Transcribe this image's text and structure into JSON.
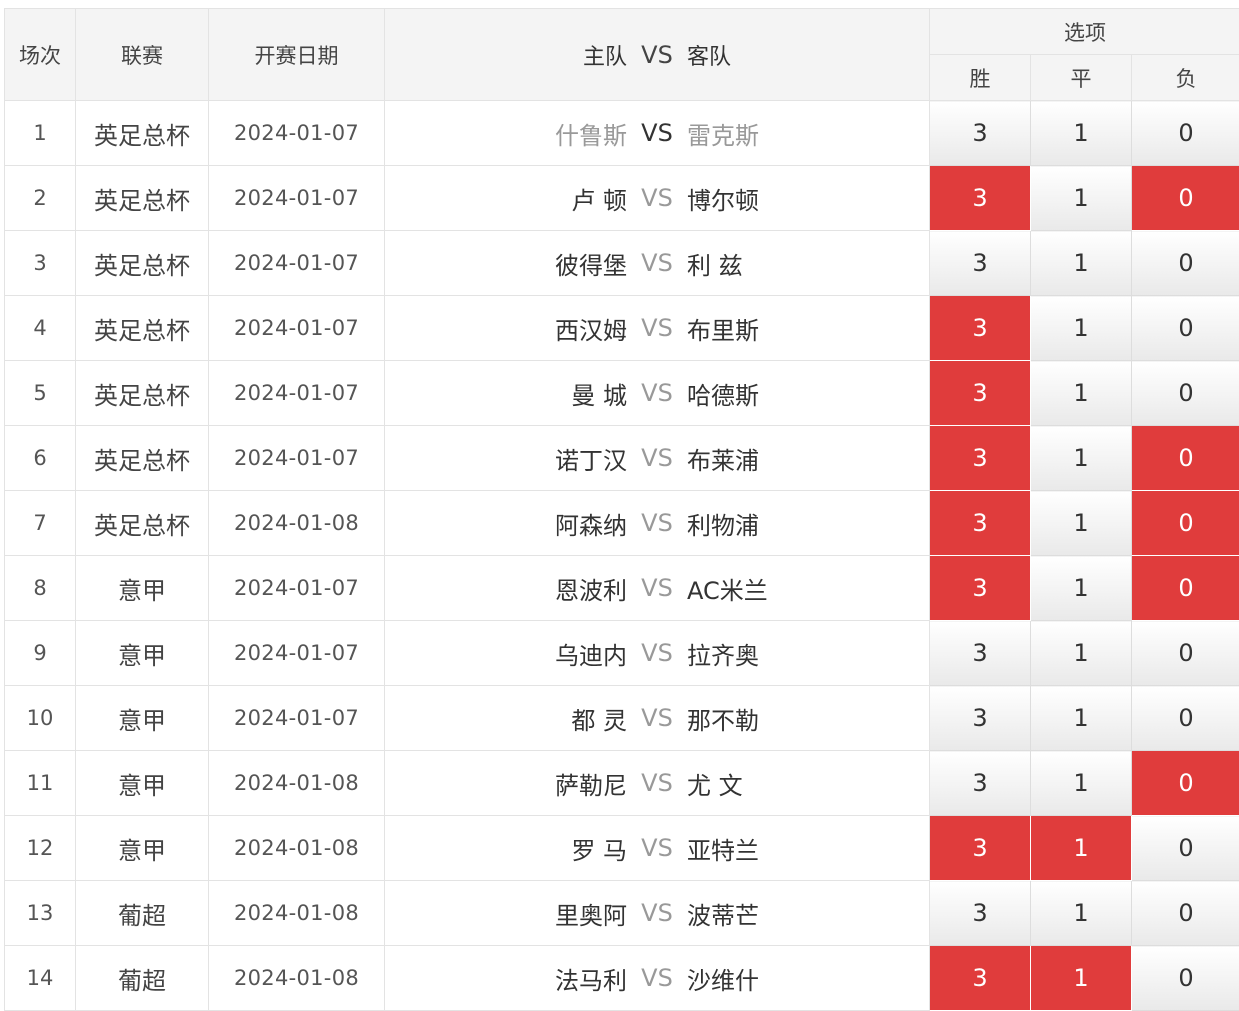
{
  "header": {
    "no": "场次",
    "league": "联赛",
    "date": "开赛日期",
    "home": "主队",
    "vs": "VS",
    "away": "客队",
    "options": "选项",
    "win": "胜",
    "draw": "平",
    "lose": "负"
  },
  "colors": {
    "selected": "#e03c3c",
    "muted_text": "#999999"
  },
  "rows": [
    {
      "no": "1",
      "league": "英足总杯",
      "date": "2024-01-07",
      "home": "什鲁斯",
      "vs": "VS",
      "away": "雷克斯",
      "muted": true,
      "win": "3",
      "draw": "1",
      "lose": "0",
      "sel": [
        false,
        false,
        false
      ]
    },
    {
      "no": "2",
      "league": "英足总杯",
      "date": "2024-01-07",
      "home": "卢 顿",
      "vs": "VS",
      "away": "博尔顿",
      "muted": false,
      "win": "3",
      "draw": "1",
      "lose": "0",
      "sel": [
        true,
        false,
        true
      ]
    },
    {
      "no": "3",
      "league": "英足总杯",
      "date": "2024-01-07",
      "home": "彼得堡",
      "vs": "VS",
      "away": "利 兹",
      "muted": false,
      "win": "3",
      "draw": "1",
      "lose": "0",
      "sel": [
        false,
        false,
        false
      ]
    },
    {
      "no": "4",
      "league": "英足总杯",
      "date": "2024-01-07",
      "home": "西汉姆",
      "vs": "VS",
      "away": "布里斯",
      "muted": false,
      "win": "3",
      "draw": "1",
      "lose": "0",
      "sel": [
        true,
        false,
        false
      ]
    },
    {
      "no": "5",
      "league": "英足总杯",
      "date": "2024-01-07",
      "home": "曼 城",
      "vs": "VS",
      "away": "哈德斯",
      "muted": false,
      "win": "3",
      "draw": "1",
      "lose": "0",
      "sel": [
        true,
        false,
        false
      ]
    },
    {
      "no": "6",
      "league": "英足总杯",
      "date": "2024-01-07",
      "home": "诺丁汉",
      "vs": "VS",
      "away": "布莱浦",
      "muted": false,
      "win": "3",
      "draw": "1",
      "lose": "0",
      "sel": [
        true,
        false,
        true
      ]
    },
    {
      "no": "7",
      "league": "英足总杯",
      "date": "2024-01-08",
      "home": "阿森纳",
      "vs": "VS",
      "away": "利物浦",
      "muted": false,
      "win": "3",
      "draw": "1",
      "lose": "0",
      "sel": [
        true,
        false,
        true
      ]
    },
    {
      "no": "8",
      "league": "意甲",
      "date": "2024-01-07",
      "home": "恩波利",
      "vs": "VS",
      "away": "AC米兰",
      "muted": false,
      "win": "3",
      "draw": "1",
      "lose": "0",
      "sel": [
        true,
        false,
        true
      ]
    },
    {
      "no": "9",
      "league": "意甲",
      "date": "2024-01-07",
      "home": "乌迪内",
      "vs": "VS",
      "away": "拉齐奥",
      "muted": false,
      "win": "3",
      "draw": "1",
      "lose": "0",
      "sel": [
        false,
        false,
        false
      ]
    },
    {
      "no": "10",
      "league": "意甲",
      "date": "2024-01-07",
      "home": "都 灵",
      "vs": "VS",
      "away": "那不勒",
      "muted": false,
      "win": "3",
      "draw": "1",
      "lose": "0",
      "sel": [
        false,
        false,
        false
      ]
    },
    {
      "no": "11",
      "league": "意甲",
      "date": "2024-01-08",
      "home": "萨勒尼",
      "vs": "VS",
      "away": "尤 文",
      "muted": false,
      "win": "3",
      "draw": "1",
      "lose": "0",
      "sel": [
        false,
        false,
        true
      ]
    },
    {
      "no": "12",
      "league": "意甲",
      "date": "2024-01-08",
      "home": "罗 马",
      "vs": "VS",
      "away": "亚特兰",
      "muted": false,
      "win": "3",
      "draw": "1",
      "lose": "0",
      "sel": [
        true,
        true,
        false
      ]
    },
    {
      "no": "13",
      "league": "葡超",
      "date": "2024-01-08",
      "home": "里奥阿",
      "vs": "VS",
      "away": "波蒂芒",
      "muted": false,
      "win": "3",
      "draw": "1",
      "lose": "0",
      "sel": [
        false,
        false,
        false
      ]
    },
    {
      "no": "14",
      "league": "葡超",
      "date": "2024-01-08",
      "home": "法马利",
      "vs": "VS",
      "away": "沙维什",
      "muted": false,
      "win": "3",
      "draw": "1",
      "lose": "0",
      "sel": [
        true,
        true,
        false
      ]
    }
  ]
}
